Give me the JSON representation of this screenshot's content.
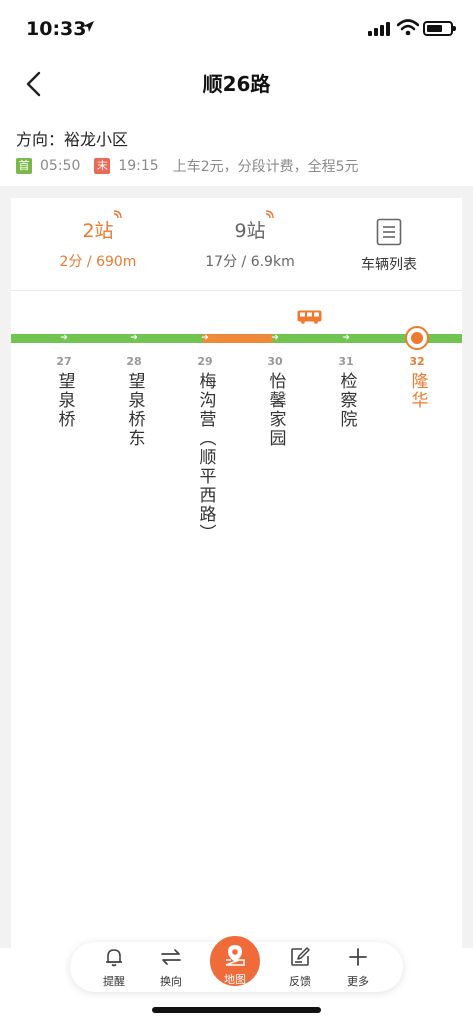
{
  "status": {
    "time": "10:33"
  },
  "nav": {
    "title": "顺26路"
  },
  "info": {
    "direction": "方向：裕龙小区",
    "first_badge": "首",
    "first_time": "05:50",
    "last_badge": "末",
    "last_time": "19:15",
    "fare": "上车2元，分段计费，全程5元"
  },
  "summary": {
    "bus1_stops": "2站",
    "bus1_detail": "2分 / 690m",
    "bus2_stops": "9站",
    "bus2_detail": "17分 / 6.9km",
    "vehicle_list": "车辆列表"
  },
  "stops": [
    {
      "num": "27",
      "name": "望泉桥"
    },
    {
      "num": "28",
      "name": "望泉桥东"
    },
    {
      "num": "29",
      "name": "梅沟营（顺平西路）"
    },
    {
      "num": "30",
      "name": "怡馨家园"
    },
    {
      "num": "31",
      "name": "检察院"
    },
    {
      "num": "32",
      "name": "隆华"
    }
  ],
  "tabbar": {
    "remind": "提醒",
    "switch": "换向",
    "map": "地图",
    "feedback": "反馈",
    "more": "更多"
  },
  "colors": {
    "accent": "#ee7a30",
    "line_green": "#72c451",
    "line_orange": "#ee8a3a"
  }
}
